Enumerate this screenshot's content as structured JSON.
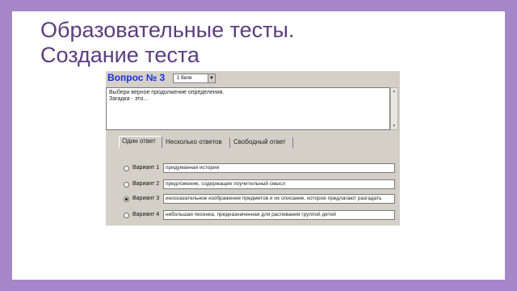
{
  "slide": {
    "title_line1": "Образовательные тесты.",
    "title_line2": "Создание теста"
  },
  "app": {
    "question_label": "Вопрос № 3",
    "level_select": "1 беля",
    "question_text_line1": "Выбери верное продолжение определения.",
    "question_text_line2": "Загадка - это...",
    "tabs": [
      {
        "label": "Один ответ",
        "active": true
      },
      {
        "label": "Несколько ответов",
        "active": false
      },
      {
        "label": "Свободный ответ",
        "active": false
      }
    ],
    "options": [
      {
        "label": "Вариант 1",
        "value": "придуманная история",
        "checked": false
      },
      {
        "label": "Вариант 2",
        "value": "предложение, содержащее поучительный смысл",
        "checked": false
      },
      {
        "label": "Вариант 3",
        "value": "иносказательное изображение предметов и их описание, которое предлагают разгадать",
        "checked": true
      },
      {
        "label": "Вариант 4",
        "value": "небольшая песенка, предназначенная для распевания группой детей",
        "checked": false
      }
    ]
  }
}
